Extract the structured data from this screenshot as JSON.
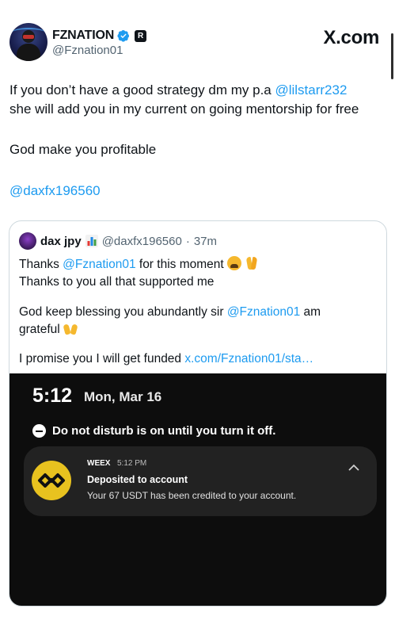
{
  "author": {
    "name": "FZNATION",
    "handle": "@Fznation01",
    "affiliate_badge": "R"
  },
  "watermark": "X.com",
  "tweet": {
    "line1_prefix": "If you don’t have a good strategy dm my p.a ",
    "line1_mention": "@lilstarr232",
    "line2": "she will add you in my current on going mentorship for free",
    "line3": "God make you profitable",
    "mention": "@daxfx196560"
  },
  "quote": {
    "name": "dax jpy",
    "handle": "@daxfx196560",
    "sep": "·",
    "age": "37m",
    "p1_prefix": "Thanks ",
    "p1_mention": "@Fznation01",
    "p1_suffix": " for this moment ",
    "p1_line2": "Thanks to you all that supported me",
    "p2_prefix": "God keep blessing you abundantly sir ",
    "p2_mention": "@Fznation01",
    "p2_suffix": " am",
    "p2_line2": "grateful ",
    "p3_prefix": "I promise you I will get funded ",
    "p3_link": "x.com/Fznation01/sta…"
  },
  "phone": {
    "time": "5:12",
    "date": "Mon, Mar 16",
    "dnd_text": "Do not disturb is on until you turn it off.",
    "notification": {
      "app": "WEEX",
      "time": "5:12 PM",
      "title": "Deposited to account",
      "body": "Your 67 USDT has been credited to your account.",
      "logo_color": "#e8c21f"
    }
  },
  "colors": {
    "link": "#1d9bf0",
    "text": "#0f1419",
    "muted": "#536471",
    "phone_bg": "#0d0d0d",
    "notif_bg": "#222222"
  },
  "icons": [
    "verified-badge-icon",
    "affiliate-badge-icon",
    "bar-chart-emoji-icon",
    "weary-face-emoji-icon",
    "folded-hands-emoji-icon",
    "raising-hands-emoji-icon",
    "dnd-minus-icon",
    "weex-logo-icon",
    "chevron-up-icon"
  ]
}
